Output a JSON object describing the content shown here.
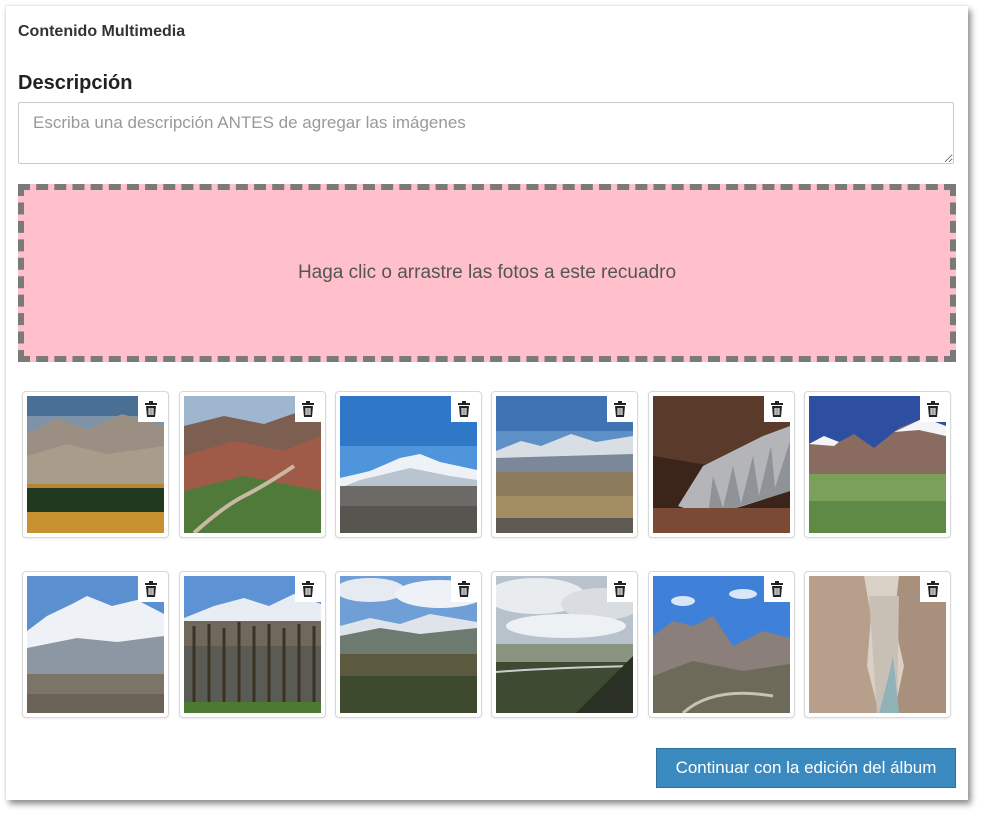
{
  "section": {
    "title": "Contenido Multimedia"
  },
  "description": {
    "label": "Descripción",
    "value": "",
    "placeholder": "Escriba una descripción ANTES de agregar las imágenes"
  },
  "dropzone": {
    "text": "Haga clic o arrastre las fotos a este recuadro",
    "background": "#ffc0cb"
  },
  "gallery": {
    "delete_icon": "trash-icon",
    "photos": [
      {
        "scene": "valley-with-poplars"
      },
      {
        "scene": "red-canyon-road"
      },
      {
        "scene": "snowy-peak-plain"
      },
      {
        "scene": "distant-snowy-range"
      },
      {
        "scene": "ice-penitentes"
      },
      {
        "scene": "snowy-mountains-green-valley"
      },
      {
        "scene": "large-snowy-massif"
      },
      {
        "scene": "poplar-grove-snowy-peaks"
      },
      {
        "scene": "cloudy-snowy-ridge"
      },
      {
        "scene": "cloudy-sky-river-valley"
      },
      {
        "scene": "rocky-hills-blue-sky"
      },
      {
        "scene": "rock-canyon-river"
      }
    ]
  },
  "actions": {
    "continue_label": "Continuar con la edición del álbum",
    "accent": "#3a8ac0"
  }
}
